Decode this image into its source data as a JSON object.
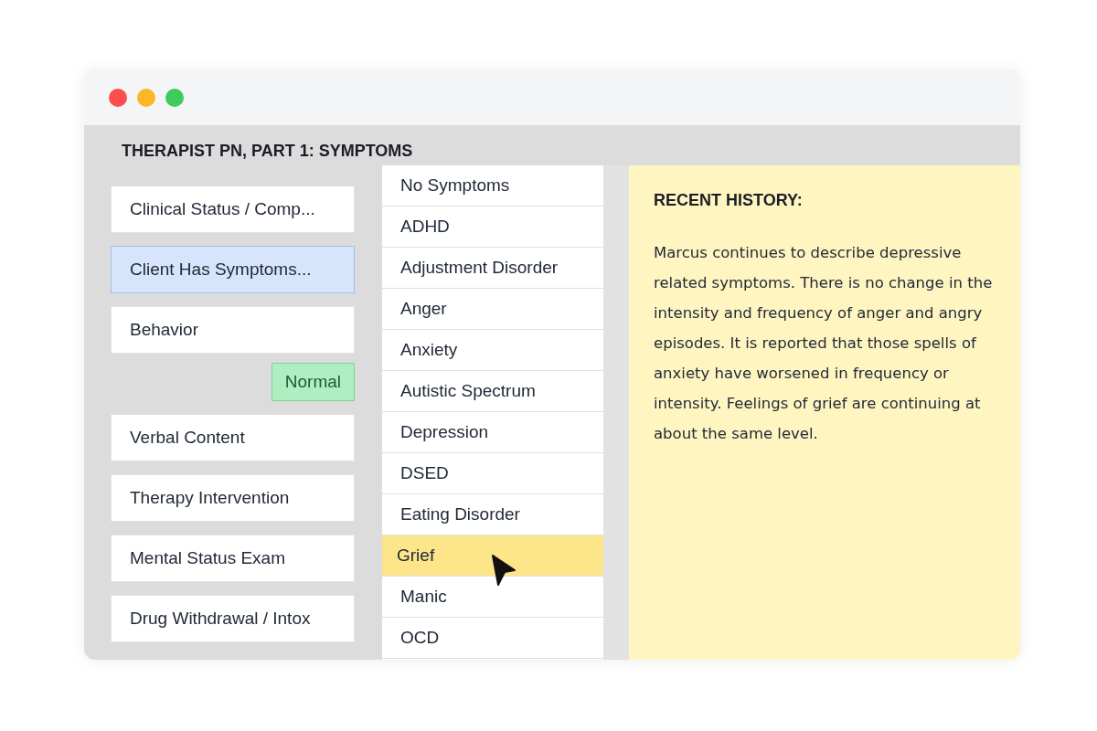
{
  "window": {
    "title": "THERAPIST PN, PART 1: SYMPTOMS"
  },
  "sections": [
    {
      "kind": "item",
      "label": "Clinical Status / Comp...",
      "selected": false
    },
    {
      "kind": "item",
      "label": "Client Has Symptoms...",
      "selected": true
    },
    {
      "kind": "item",
      "label": "Behavior",
      "selected": false
    },
    {
      "kind": "badge",
      "label": "Normal"
    },
    {
      "kind": "item",
      "label": "Verbal Content",
      "selected": false
    },
    {
      "kind": "item",
      "label": "Therapy Intervention",
      "selected": false
    },
    {
      "kind": "item",
      "label": "Mental Status Exam",
      "selected": false
    },
    {
      "kind": "item",
      "label": "Drug Withdrawal / Intox",
      "selected": false
    }
  ],
  "symptoms": [
    {
      "label": "No Symptoms",
      "selected": false
    },
    {
      "label": "ADHD",
      "selected": false
    },
    {
      "label": "Adjustment Disorder",
      "selected": false
    },
    {
      "label": "Anger",
      "selected": false
    },
    {
      "label": "Anxiety",
      "selected": false
    },
    {
      "label": "Autistic Spectrum",
      "selected": false
    },
    {
      "label": "Depression",
      "selected": false
    },
    {
      "label": "DSED",
      "selected": false
    },
    {
      "label": "Eating Disorder",
      "selected": false
    },
    {
      "label": "Grief",
      "selected": true
    },
    {
      "label": "Manic",
      "selected": false
    },
    {
      "label": "OCD",
      "selected": false
    }
  ],
  "history": {
    "heading": "RECENT HISTORY:",
    "text": "Marcus continues to describe depressive related symptoms. There is no change in the intensity and frequency of anger and angry episodes. It is reported that those spells of anxiety have worsened in frequency or intensity. Feelings of grief are continuing at about the same level."
  }
}
